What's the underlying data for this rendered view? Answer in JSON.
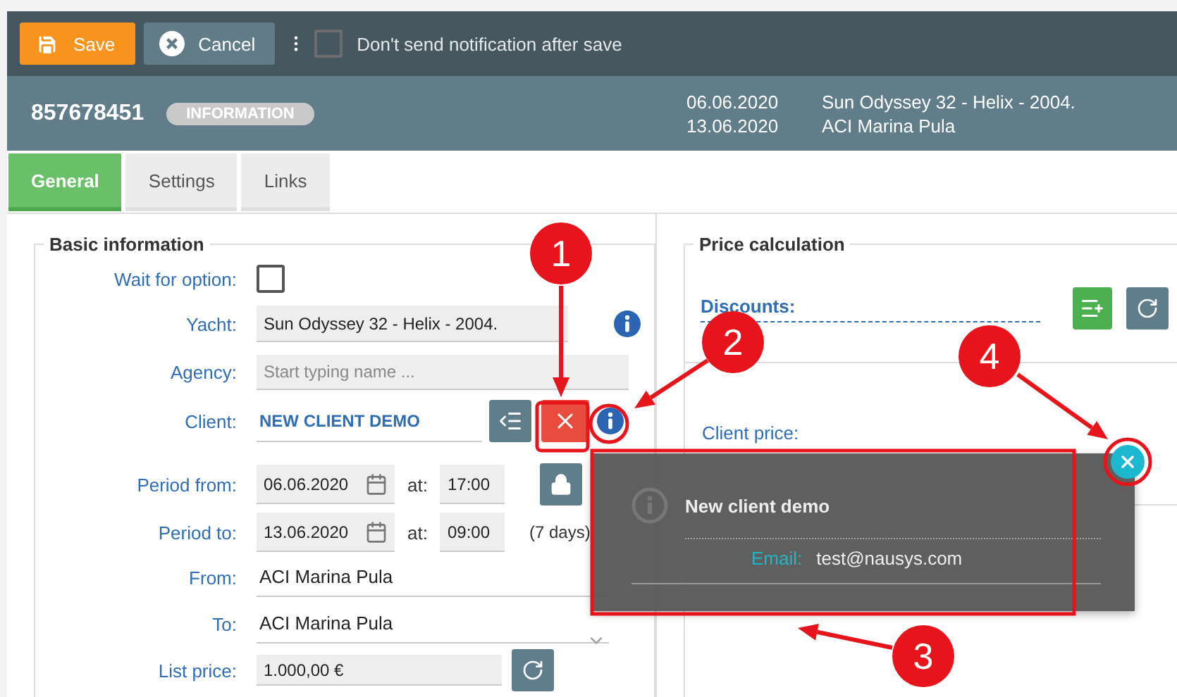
{
  "toolbar": {
    "buttons": [
      {
        "kind": "save",
        "label": "Save"
      },
      {
        "kind": "cancel",
        "label": "Cancel"
      }
    ],
    "notify": {
      "label": "Don't send notification after save",
      "checked": false
    }
  },
  "header": {
    "number": "857678451",
    "badge": "INFORMATION",
    "dates": [
      "06.06.2020",
      "13.06.2020"
    ],
    "details": [
      "Sun Odyssey 32 - Helix - 2004.",
      "ACI Marina Pula"
    ]
  },
  "tabs": [
    {
      "label": "General",
      "selected": true
    },
    {
      "label": "Settings",
      "selected": false
    },
    {
      "label": "Links",
      "selected": false
    }
  ],
  "basic_information": {
    "title": "Basic information",
    "wait_for_option": {
      "label": "Wait for option:",
      "checked": false
    },
    "yacht": {
      "label": "Yacht:",
      "value": "Sun Odyssey 32 - Helix - 2004."
    },
    "agency": {
      "label": "Agency:",
      "placeholder": "Start typing name ..."
    },
    "client": {
      "label": "Client:",
      "value": "NEW CLIENT DEMO"
    },
    "period_from": {
      "label": "Period from:",
      "date": "06.06.2020",
      "at": "at:",
      "time": "17:00"
    },
    "period_to": {
      "label": "Period to:",
      "date": "13.06.2020",
      "at": "at:",
      "time": "09:00",
      "days": "(7 days)"
    },
    "from": {
      "label": "From:",
      "value": "ACI Marina Pula"
    },
    "to": {
      "label": "To:",
      "value": "ACI Marina Pula"
    },
    "list_price": {
      "label": "List price:",
      "value": "1.000,00 €"
    }
  },
  "price_calculation": {
    "title": "Price calculation",
    "discounts": "Discounts:",
    "client_price": "Client price:"
  },
  "client_popup": {
    "title": "New client demo",
    "email_label": "Email:",
    "email": "test@nausys.com"
  },
  "annotations": [
    {
      "number": "1"
    },
    {
      "number": "2"
    },
    {
      "number": "3"
    },
    {
      "number": "4"
    }
  ]
}
